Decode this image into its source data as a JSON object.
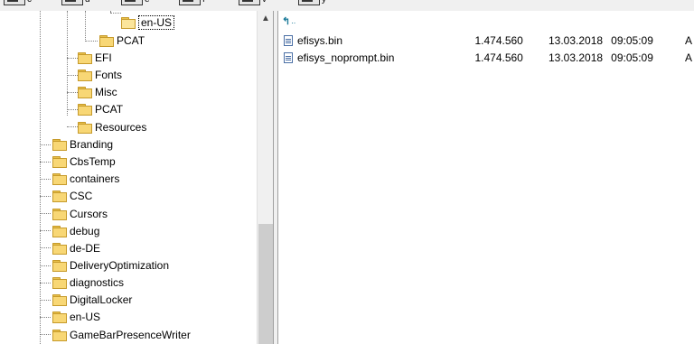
{
  "drives": [
    {
      "letter": "c"
    },
    {
      "letter": "d"
    },
    {
      "letter": "e"
    },
    {
      "letter": "f"
    },
    {
      "letter": "v"
    },
    {
      "letter": "y"
    }
  ],
  "tree": {
    "items": [
      {
        "label": "en-US",
        "selected": true,
        "open": true
      },
      {
        "label": "PCAT"
      },
      {
        "label": "EFI"
      },
      {
        "label": "Fonts"
      },
      {
        "label": "Misc"
      },
      {
        "label": "PCAT"
      },
      {
        "label": "Resources"
      },
      {
        "label": "Branding"
      },
      {
        "label": "CbsTemp"
      },
      {
        "label": "containers"
      },
      {
        "label": "CSC"
      },
      {
        "label": "Cursors"
      },
      {
        "label": "debug"
      },
      {
        "label": "de-DE"
      },
      {
        "label": "DeliveryOptimization"
      },
      {
        "label": "diagnostics"
      },
      {
        "label": "DigitalLocker"
      },
      {
        "label": "en-US"
      },
      {
        "label": "GameBarPresenceWriter"
      }
    ]
  },
  "files": {
    "up_label": "..",
    "rows": [
      {
        "name": "efisys.bin",
        "size": "1.474.560",
        "date": "13.03.2018",
        "time": "09:05:09",
        "attr": "A"
      },
      {
        "name": "efisys_noprompt.bin",
        "size": "1.474.560",
        "date": "13.03.2018",
        "time": "09:05:09",
        "attr": "A"
      }
    ]
  },
  "scrollbar": {
    "up_arrow": "▲"
  }
}
